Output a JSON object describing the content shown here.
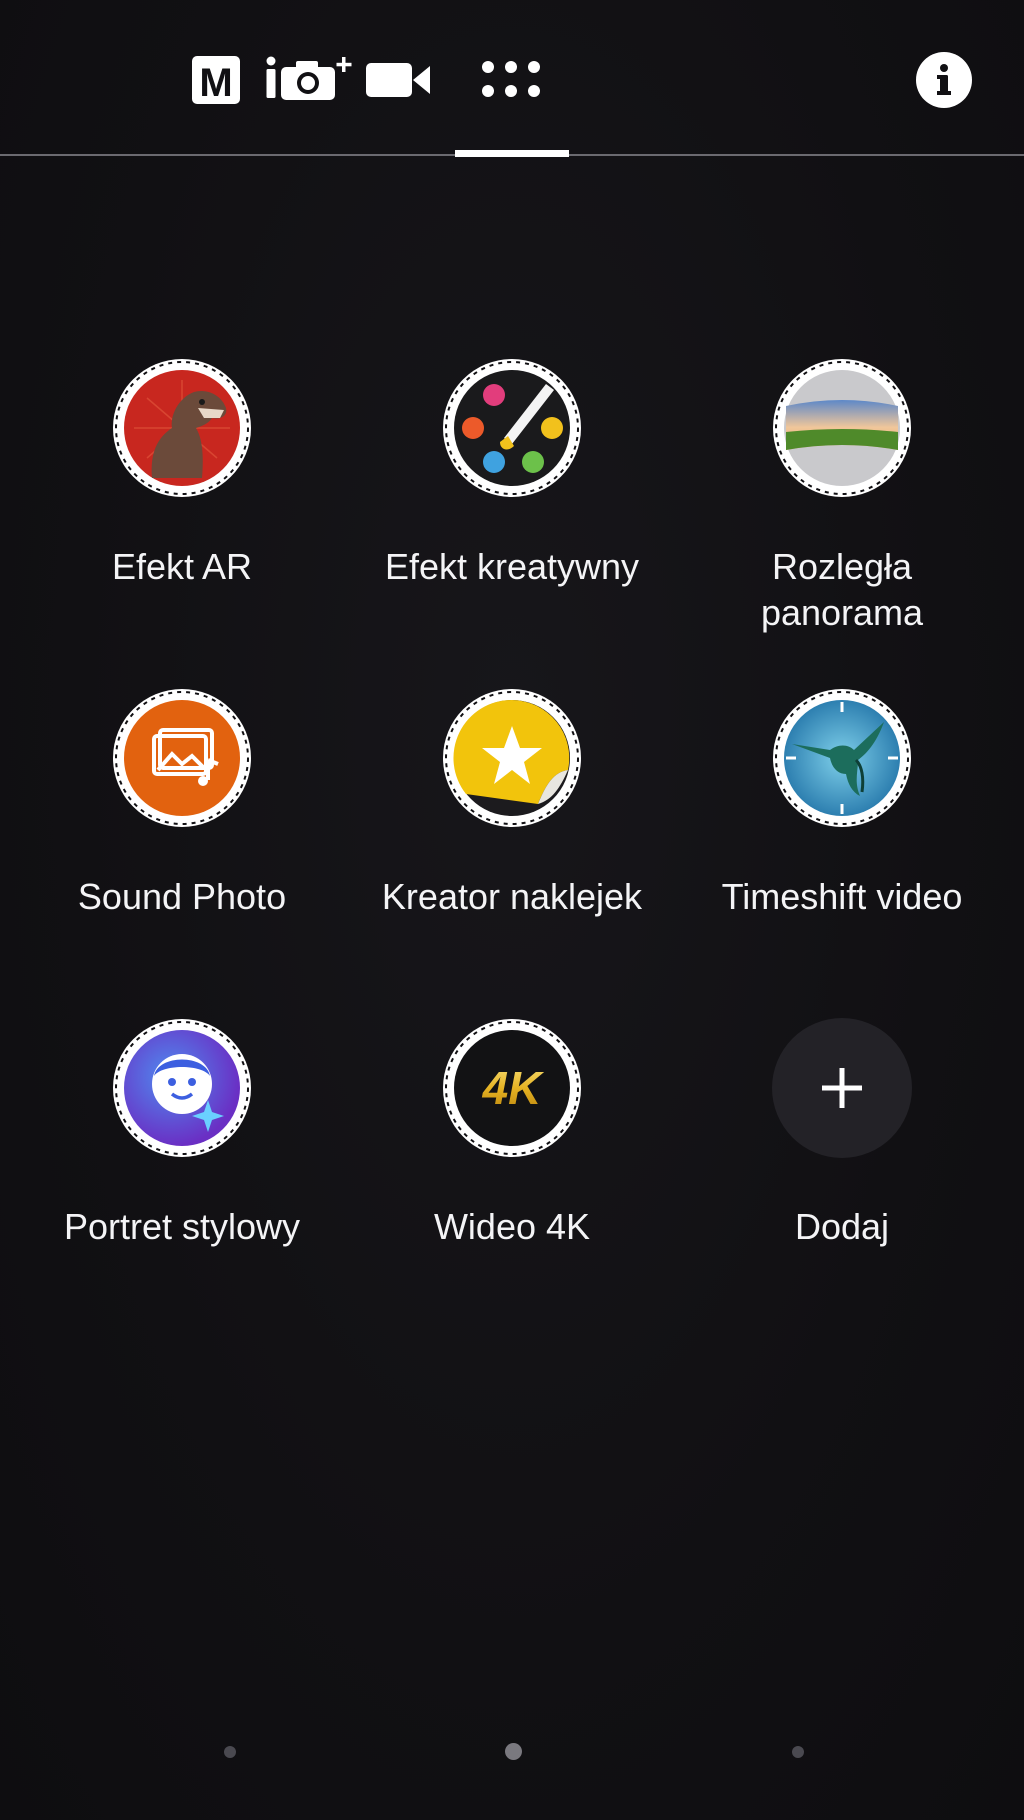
{
  "mode_bar": {
    "manual_icon": "manual-mode-icon",
    "superior_auto_icon": "superior-auto-camera-icon",
    "video_icon": "video-camera-icon",
    "apps_icon": "camera-apps-grid-icon",
    "info_icon": "info-icon",
    "manual_letter": "M",
    "active_mode": "apps"
  },
  "apps": [
    {
      "label": "Efekt AR",
      "icon": "ar-effect-dinosaur-icon"
    },
    {
      "label": "Efekt kreatywny",
      "icon": "creative-effect-palette-icon"
    },
    {
      "label": "Rozległa\npanorama",
      "icon": "sweep-panorama-icon"
    },
    {
      "label": "Sound Photo",
      "icon": "sound-photo-icon"
    },
    {
      "label": "Kreator naklejek",
      "icon": "sticker-creator-icon"
    },
    {
      "label": "Timeshift video",
      "icon": "timeshift-video-hummingbird-icon"
    },
    {
      "label": "Portret stylowy",
      "icon": "style-portrait-face-icon"
    },
    {
      "label": "Wideo 4K",
      "icon": "4k-video-icon"
    },
    {
      "label": "Dodaj",
      "icon": "add-plus-icon"
    }
  ],
  "badge_text_4k": "4K",
  "page_indicator": {
    "count": 3,
    "current": 2
  },
  "colors": {
    "background": "#111013",
    "ar_red": "#c8271f",
    "sound_photo_orange": "#e2620f",
    "sticker_yellow": "#f2c40c",
    "timeshift_blue": "#3aa6cf",
    "portrait_blue": "#3c5fe0",
    "add_button_bg": "#232227"
  }
}
